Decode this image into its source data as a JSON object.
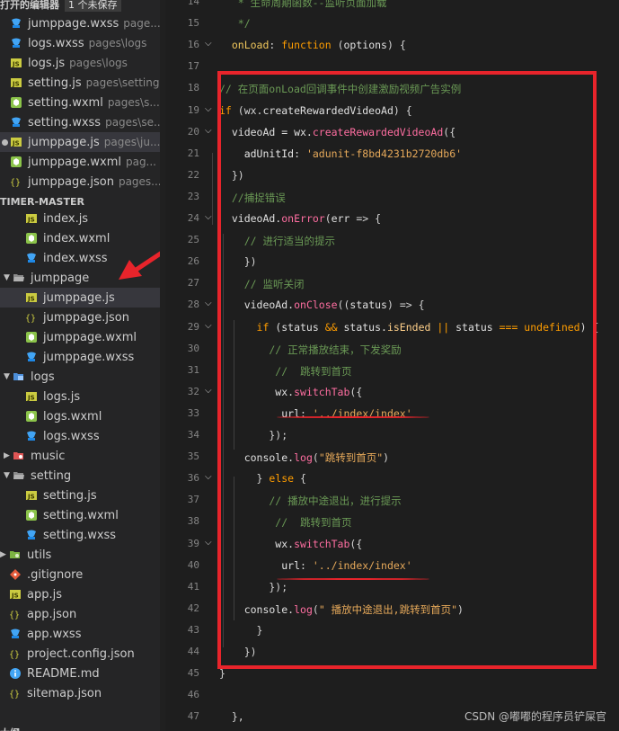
{
  "sidebar": {
    "open_editors": [
      {
        "icon": "wxss-file-icon",
        "name": "jumppage.wxss",
        "desc": "page..."
      },
      {
        "icon": "wxss-file-icon",
        "name": "logs.wxss",
        "desc": "pages\\logs"
      },
      {
        "icon": "js-file-icon",
        "name": "logs.js",
        "desc": "pages\\logs"
      },
      {
        "icon": "js-file-icon",
        "name": "setting.js",
        "desc": "pages\\setting"
      },
      {
        "icon": "wxml-file-icon",
        "name": "setting.wxml",
        "desc": "pages\\s..."
      },
      {
        "icon": "wxss-file-icon",
        "name": "setting.wxss",
        "desc": "pages\\se..."
      },
      {
        "icon": "js-file-icon",
        "name": "jumppage.js",
        "desc": "pages\\ju..."
      },
      {
        "icon": "wxml-file-icon",
        "name": "jumppage.wxml",
        "desc": "pag..."
      },
      {
        "icon": "json-file-icon",
        "name": "jumppage.json",
        "desc": "pages..."
      }
    ],
    "header_partial": "打开的编辑器",
    "unsaved_badge": "1 个未保存",
    "project": "TIMER-MASTER",
    "tree": [
      {
        "type": "file",
        "icon": "js-file-icon",
        "name": "index.js",
        "depth": 2
      },
      {
        "type": "file",
        "icon": "wxml-file-icon",
        "name": "index.wxml",
        "depth": 2
      },
      {
        "type": "file",
        "icon": "wxss-file-icon",
        "name": "index.wxss",
        "depth": 2
      },
      {
        "type": "folder",
        "icon": "folder-open-icon",
        "name": "jumppage",
        "depth": 1,
        "open": true
      },
      {
        "type": "file",
        "icon": "js-file-icon",
        "name": "jumppage.js",
        "depth": 2,
        "active": true
      },
      {
        "type": "file",
        "icon": "json-file-icon",
        "name": "jumppage.json",
        "depth": 2
      },
      {
        "type": "file",
        "icon": "wxml-file-icon",
        "name": "jumppage.wxml",
        "depth": 2
      },
      {
        "type": "file",
        "icon": "wxss-file-icon",
        "name": "jumppage.wxss",
        "depth": 2
      },
      {
        "type": "folder",
        "icon": "logs-folder-icon",
        "name": "logs",
        "depth": 1,
        "open": true
      },
      {
        "type": "file",
        "icon": "js-file-icon",
        "name": "logs.js",
        "depth": 2
      },
      {
        "type": "file",
        "icon": "wxml-file-icon",
        "name": "logs.wxml",
        "depth": 2
      },
      {
        "type": "file",
        "icon": "wxss-file-icon",
        "name": "logs.wxss",
        "depth": 2
      },
      {
        "type": "folder",
        "icon": "music-folder-icon",
        "name": "music",
        "depth": 1,
        "open": false
      },
      {
        "type": "folder",
        "icon": "folder-open-icon",
        "name": "setting",
        "depth": 1,
        "open": true
      },
      {
        "type": "file",
        "icon": "js-file-icon",
        "name": "setting.js",
        "depth": 2
      },
      {
        "type": "file",
        "icon": "wxml-file-icon",
        "name": "setting.wxml",
        "depth": 2
      },
      {
        "type": "file",
        "icon": "wxss-file-icon",
        "name": "setting.wxss",
        "depth": 2
      },
      {
        "type": "folder",
        "icon": "utils-folder-icon",
        "name": "utils",
        "depth": 0,
        "open": false
      },
      {
        "type": "file",
        "icon": "git-file-icon",
        "name": ".gitignore",
        "depth": 0
      },
      {
        "type": "file",
        "icon": "js-file-icon",
        "name": "app.js",
        "depth": 0
      },
      {
        "type": "file",
        "icon": "json-file-icon",
        "name": "app.json",
        "depth": 0
      },
      {
        "type": "file",
        "icon": "wxss-file-icon",
        "name": "app.wxss",
        "depth": 0
      },
      {
        "type": "file",
        "icon": "json-file-icon",
        "name": "project.config.json",
        "depth": 0
      },
      {
        "type": "file",
        "icon": "info-file-icon",
        "name": "README.md",
        "depth": 0
      },
      {
        "type": "file",
        "icon": "json-file-icon",
        "name": "sitemap.json",
        "depth": 0
      }
    ],
    "bottom_partial": "大纲"
  },
  "editor": {
    "lines": [
      {
        "n": "14",
        "fold": false,
        "tokens": [
          [
            "   * 生命周期函数--监听页面加载",
            "c-com"
          ]
        ]
      },
      {
        "n": "15",
        "fold": false,
        "tokens": [
          [
            "   */",
            "c-com"
          ]
        ]
      },
      {
        "n": "16",
        "fold": true,
        "tokens": [
          [
            "  onLoad",
            "c-yel"
          ],
          [
            ": ",
            "c-pun"
          ],
          [
            "function",
            "c-kw"
          ],
          [
            " (",
            "c-pun"
          ],
          [
            "options",
            "c-var"
          ],
          [
            ") {",
            "c-pun"
          ]
        ]
      },
      {
        "n": "17",
        "fold": false,
        "tokens": []
      },
      {
        "n": "18",
        "fold": false,
        "tokens": [
          [
            "// 在页面onLoad回调事件中创建激励视频广告实例",
            "c-com"
          ]
        ]
      },
      {
        "n": "19",
        "fold": true,
        "tokens": [
          [
            "if",
            "c-kw"
          ],
          [
            " (wx.",
            "c-pun"
          ],
          [
            "createRewardedVideoAd",
            "c-var"
          ],
          [
            ") {",
            "c-pun"
          ]
        ]
      },
      {
        "n": "20",
        "fold": true,
        "tokens": [
          [
            "  videoAd = wx.",
            "c-var"
          ],
          [
            "createRewardedVideoAd",
            "c-fn"
          ],
          [
            "({",
            "c-pun"
          ]
        ]
      },
      {
        "n": "21",
        "fold": false,
        "tokens": [
          [
            "    adUnitId",
            "c-key"
          ],
          [
            ": ",
            "c-pun"
          ],
          [
            "'adunit-f8bd4231b2720db6'",
            "c-str"
          ]
        ]
      },
      {
        "n": "22",
        "fold": false,
        "tokens": [
          [
            "  })",
            "c-pun"
          ]
        ]
      },
      {
        "n": "23",
        "fold": false,
        "tokens": [
          [
            "  //捕捉错误",
            "c-com"
          ]
        ]
      },
      {
        "n": "24",
        "fold": true,
        "tokens": [
          [
            "  videoAd.",
            "c-var"
          ],
          [
            "onError",
            "c-fn"
          ],
          [
            "(",
            "c-pun"
          ],
          [
            "err",
            "c-var"
          ],
          [
            " => {",
            "c-pun"
          ]
        ]
      },
      {
        "n": "25",
        "fold": false,
        "tokens": [
          [
            "    // 进行适当的提示",
            "c-com"
          ]
        ]
      },
      {
        "n": "26",
        "fold": false,
        "tokens": [
          [
            "    })",
            "c-pun"
          ]
        ]
      },
      {
        "n": "27",
        "fold": false,
        "tokens": [
          [
            "    // 监听关闭",
            "c-com"
          ]
        ]
      },
      {
        "n": "28",
        "fold": true,
        "tokens": [
          [
            "    videoAd.",
            "c-var"
          ],
          [
            "onClose",
            "c-fn"
          ],
          [
            "((",
            "c-pun"
          ],
          [
            "status",
            "c-var"
          ],
          [
            ") => {",
            "c-pun"
          ]
        ]
      },
      {
        "n": "29",
        "fold": true,
        "tokens": [
          [
            "      if",
            "c-kw"
          ],
          [
            " (status ",
            "c-var"
          ],
          [
            "&&",
            "c-kw"
          ],
          [
            " status.",
            "c-var"
          ],
          [
            "isEnded",
            "c-prop"
          ],
          [
            " || ",
            "c-kw"
          ],
          [
            "status ",
            "c-var"
          ],
          [
            "===",
            "c-kw"
          ],
          [
            " undefined",
            "c-kw"
          ],
          [
            ") {",
            "c-pun"
          ]
        ]
      },
      {
        "n": "30",
        "fold": false,
        "tokens": [
          [
            "        // 正常播放结束，下发奖励",
            "c-com"
          ]
        ]
      },
      {
        "n": "31",
        "fold": false,
        "tokens": [
          [
            "         //  跳转到首页",
            "c-com"
          ]
        ]
      },
      {
        "n": "32",
        "fold": true,
        "tokens": [
          [
            "         wx.",
            "c-var"
          ],
          [
            "switchTab",
            "c-fn"
          ],
          [
            "({",
            "c-pun"
          ]
        ]
      },
      {
        "n": "33",
        "fold": false,
        "tokens": [
          [
            "          url",
            "c-key"
          ],
          [
            ": ",
            "c-pun"
          ],
          [
            "'../index/index'",
            "c-str"
          ]
        ]
      },
      {
        "n": "34",
        "fold": false,
        "tokens": [
          [
            "        });",
            "c-pun"
          ]
        ]
      },
      {
        "n": "35",
        "fold": false,
        "tokens": [
          [
            "    console.",
            "c-var"
          ],
          [
            "log",
            "c-fn"
          ],
          [
            "(",
            "c-pun"
          ],
          [
            "\"跳转到首页\"",
            "c-str"
          ],
          [
            ")",
            "c-pun"
          ]
        ]
      },
      {
        "n": "36",
        "fold": true,
        "tokens": [
          [
            "      } ",
            "c-pun"
          ],
          [
            "else",
            "c-kw"
          ],
          [
            " {",
            "c-pun"
          ]
        ]
      },
      {
        "n": "37",
        "fold": false,
        "tokens": [
          [
            "        // 播放中途退出，进行提示",
            "c-com"
          ]
        ]
      },
      {
        "n": "38",
        "fold": false,
        "tokens": [
          [
            "         //  跳转到首页",
            "c-com"
          ]
        ]
      },
      {
        "n": "39",
        "fold": true,
        "tokens": [
          [
            "         wx.",
            "c-var"
          ],
          [
            "switchTab",
            "c-fn"
          ],
          [
            "({",
            "c-pun"
          ]
        ]
      },
      {
        "n": "40",
        "fold": false,
        "tokens": [
          [
            "          url",
            "c-key"
          ],
          [
            ": ",
            "c-pun"
          ],
          [
            "'../index/index'",
            "c-str"
          ]
        ]
      },
      {
        "n": "41",
        "fold": false,
        "tokens": [
          [
            "        });",
            "c-pun"
          ]
        ]
      },
      {
        "n": "42",
        "fold": false,
        "tokens": [
          [
            "    console.",
            "c-var"
          ],
          [
            "log",
            "c-fn"
          ],
          [
            "(",
            "c-pun"
          ],
          [
            "\" 播放中途退出,跳转到首页\"",
            "c-str"
          ],
          [
            ")",
            "c-pun"
          ]
        ]
      },
      {
        "n": "43",
        "fold": false,
        "tokens": [
          [
            "      }",
            "c-pun"
          ]
        ]
      },
      {
        "n": "44",
        "fold": false,
        "tokens": [
          [
            "    })",
            "c-pun"
          ]
        ]
      },
      {
        "n": "45",
        "fold": false,
        "tokens": [
          [
            "}",
            "c-pun"
          ]
        ]
      },
      {
        "n": "46",
        "fold": false,
        "tokens": []
      },
      {
        "n": "47",
        "fold": false,
        "tokens": [
          [
            "  },",
            "c-pun"
          ]
        ]
      }
    ]
  },
  "annotation": {
    "box_color": "#e8242b"
  },
  "watermark": "CSDN @嘟嘟的程序员铲屎官"
}
